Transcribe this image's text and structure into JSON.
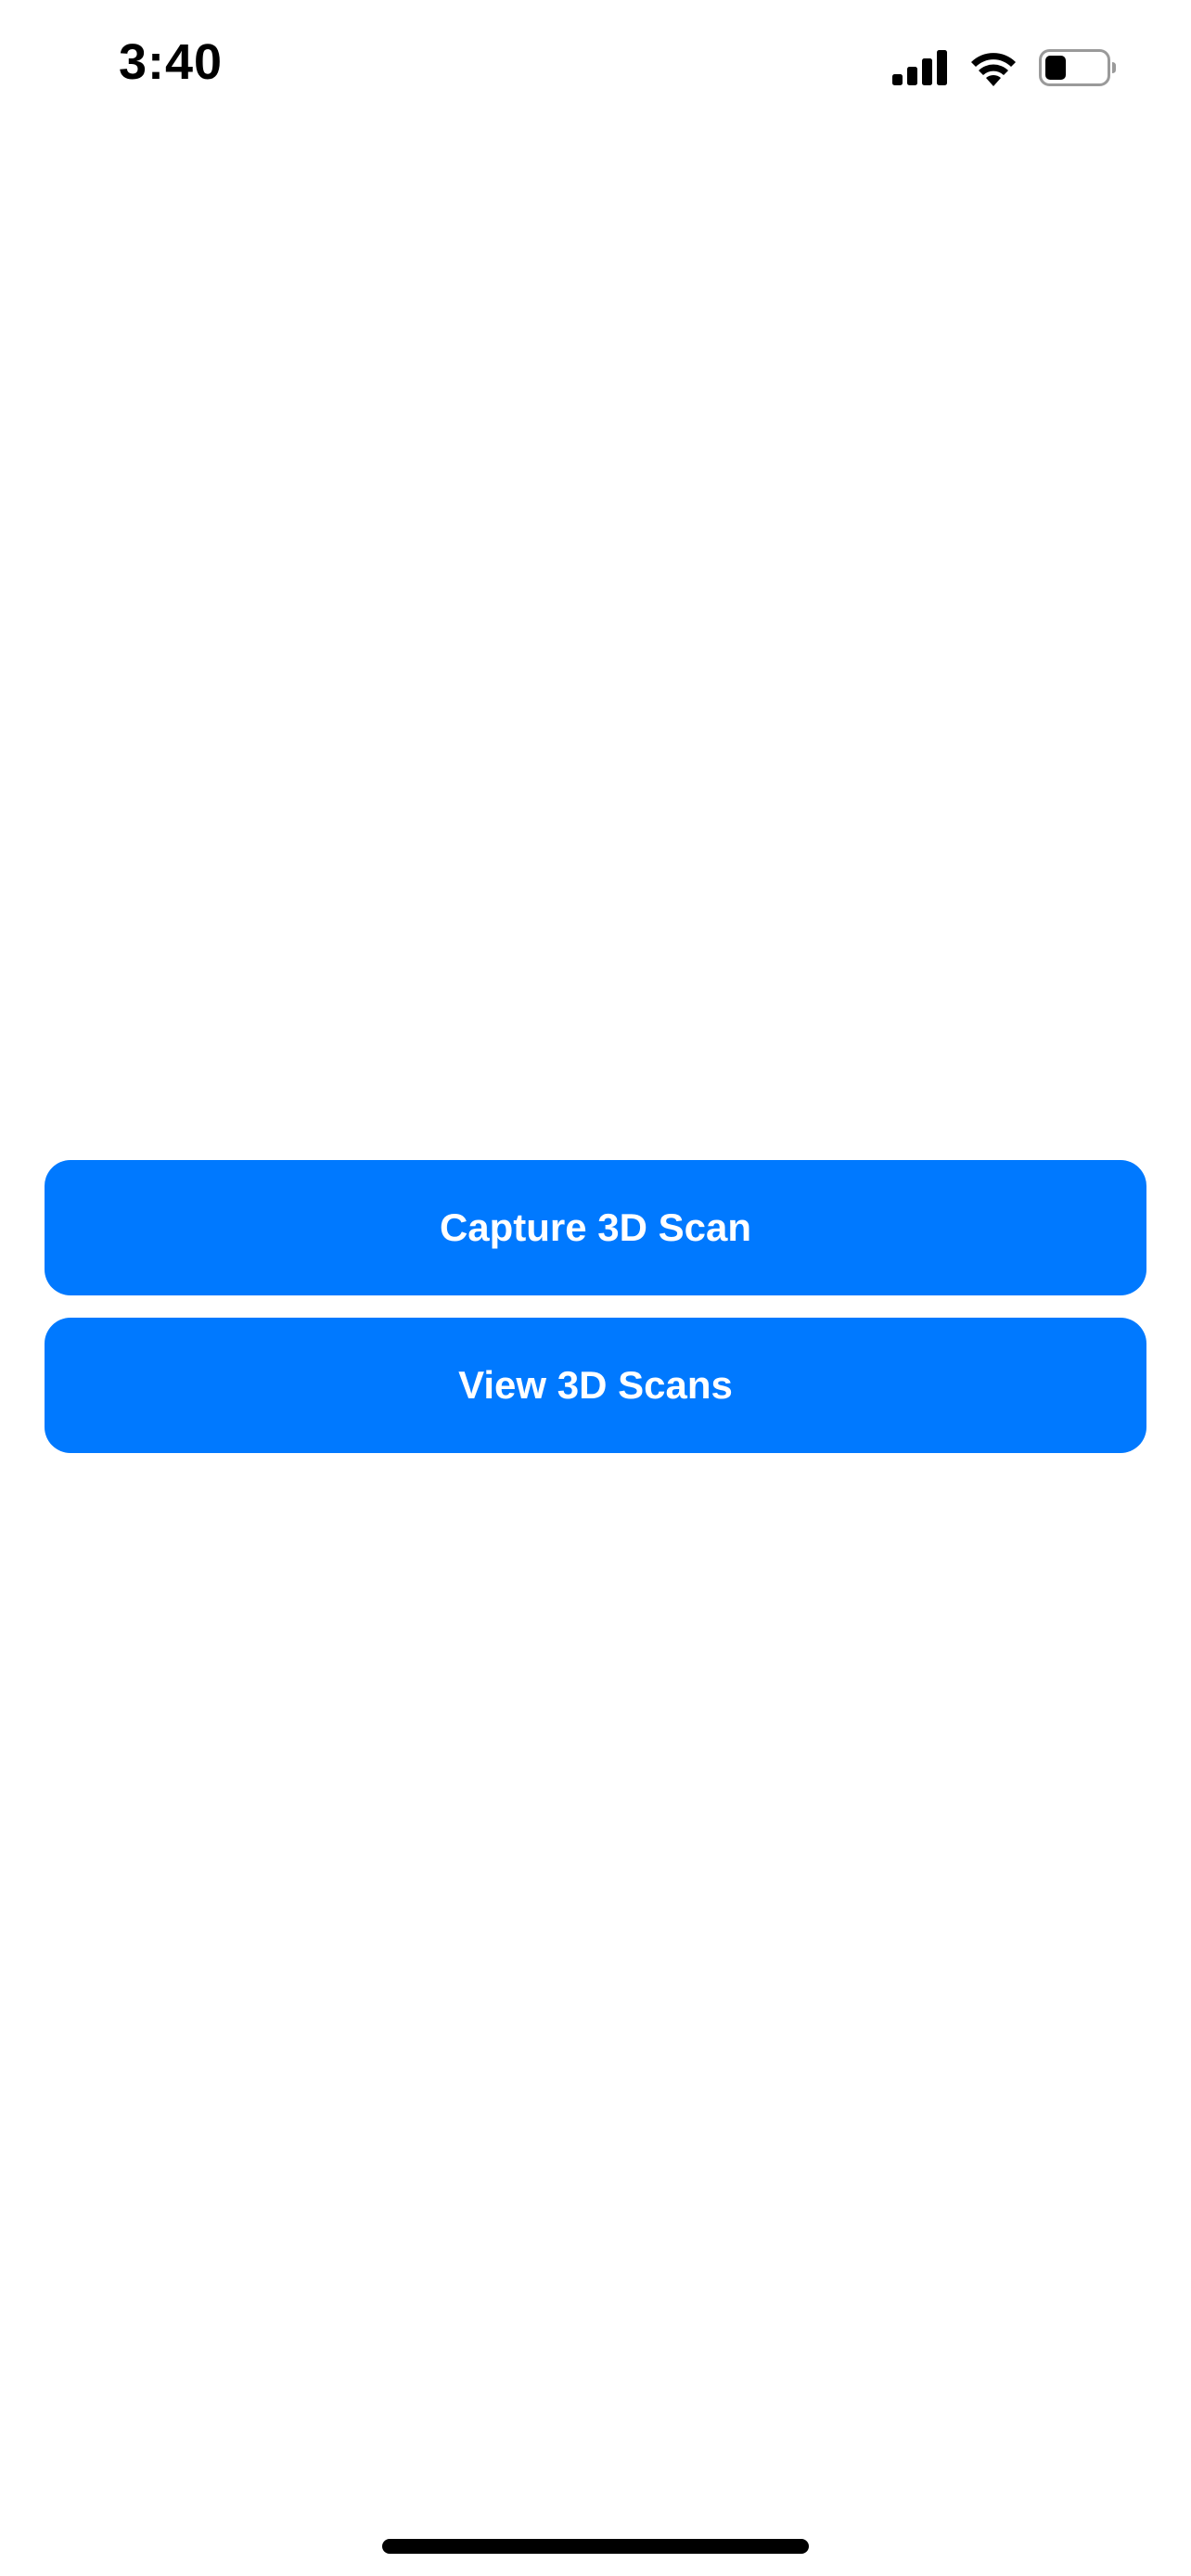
{
  "status_bar": {
    "time": "3:40",
    "icons": [
      "cellular-signal-icon",
      "wifi-icon",
      "battery-icon"
    ],
    "battery_level": 0.35
  },
  "main": {
    "buttons": [
      {
        "label": "Capture 3D Scan"
      },
      {
        "label": "View 3D Scans"
      }
    ]
  },
  "colors": {
    "accent": "#0079FF",
    "background": "#FFFFFF",
    "button_text": "#FFFFFF"
  }
}
